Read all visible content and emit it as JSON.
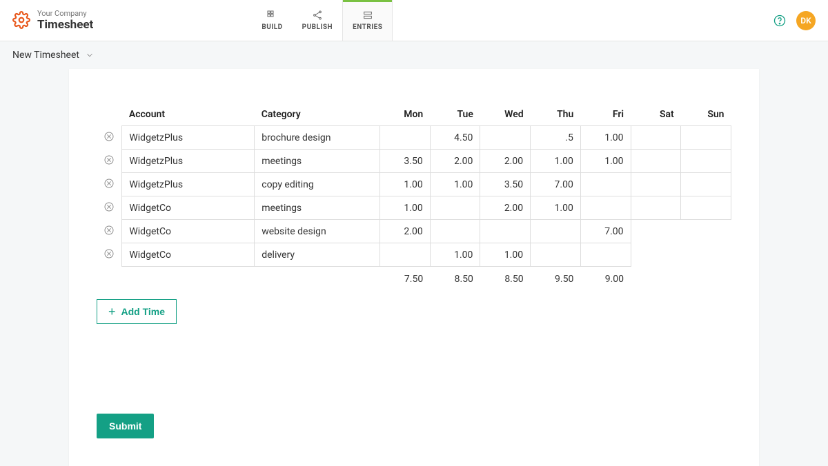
{
  "brand": {
    "company": "Your Company",
    "title": "Timesheet"
  },
  "topnav": {
    "build": "BUILD",
    "publish": "PUBLISH",
    "entries": "ENTRIES"
  },
  "avatar_initials": "DK",
  "subbar": {
    "title": "New Timesheet"
  },
  "table": {
    "headers": {
      "account": "Account",
      "category": "Category",
      "mon": "Mon",
      "tue": "Tue",
      "wed": "Wed",
      "thu": "Thu",
      "fri": "Fri",
      "sat": "Sat",
      "sun": "Sun"
    },
    "rows": [
      {
        "account": "WidgetzPlus",
        "category": "brochure design",
        "mon": "",
        "tue": "4.50",
        "wed": "",
        "thu": ".5",
        "fri": "1.00",
        "sat": "",
        "sun": "",
        "boxed_days": 7
      },
      {
        "account": "WidgetzPlus",
        "category": "meetings",
        "mon": "3.50",
        "tue": "2.00",
        "wed": "2.00",
        "thu": "1.00",
        "fri": "1.00",
        "sat": "",
        "sun": "",
        "boxed_days": 7
      },
      {
        "account": "WidgetzPlus",
        "category": "copy editing",
        "mon": "1.00",
        "tue": "1.00",
        "wed": "3.50",
        "thu": "7.00",
        "fri": "",
        "sat": "",
        "sun": "",
        "boxed_days": 7
      },
      {
        "account": "WidgetCo",
        "category": "meetings",
        "mon": "1.00",
        "tue": "",
        "wed": "2.00",
        "thu": "1.00",
        "fri": "",
        "sat": "",
        "sun": "",
        "boxed_days": 7
      },
      {
        "account": "WidgetCo",
        "category": "website design",
        "mon": "2.00",
        "tue": "",
        "wed": "",
        "thu": "",
        "fri": "7.00",
        "sat": "",
        "sun": "",
        "boxed_days": 5
      },
      {
        "account": "WidgetCo",
        "category": "delivery",
        "mon": "",
        "tue": "1.00",
        "wed": "1.00",
        "thu": "",
        "fri": "",
        "sat": "",
        "sun": "",
        "boxed_days": 5
      }
    ],
    "totals": {
      "mon": "7.50",
      "tue": "8.50",
      "wed": "8.50",
      "thu": "9.50",
      "fri": "9.00",
      "sat": "",
      "sun": ""
    }
  },
  "buttons": {
    "add_time": "Add Time",
    "submit": "Submit"
  }
}
